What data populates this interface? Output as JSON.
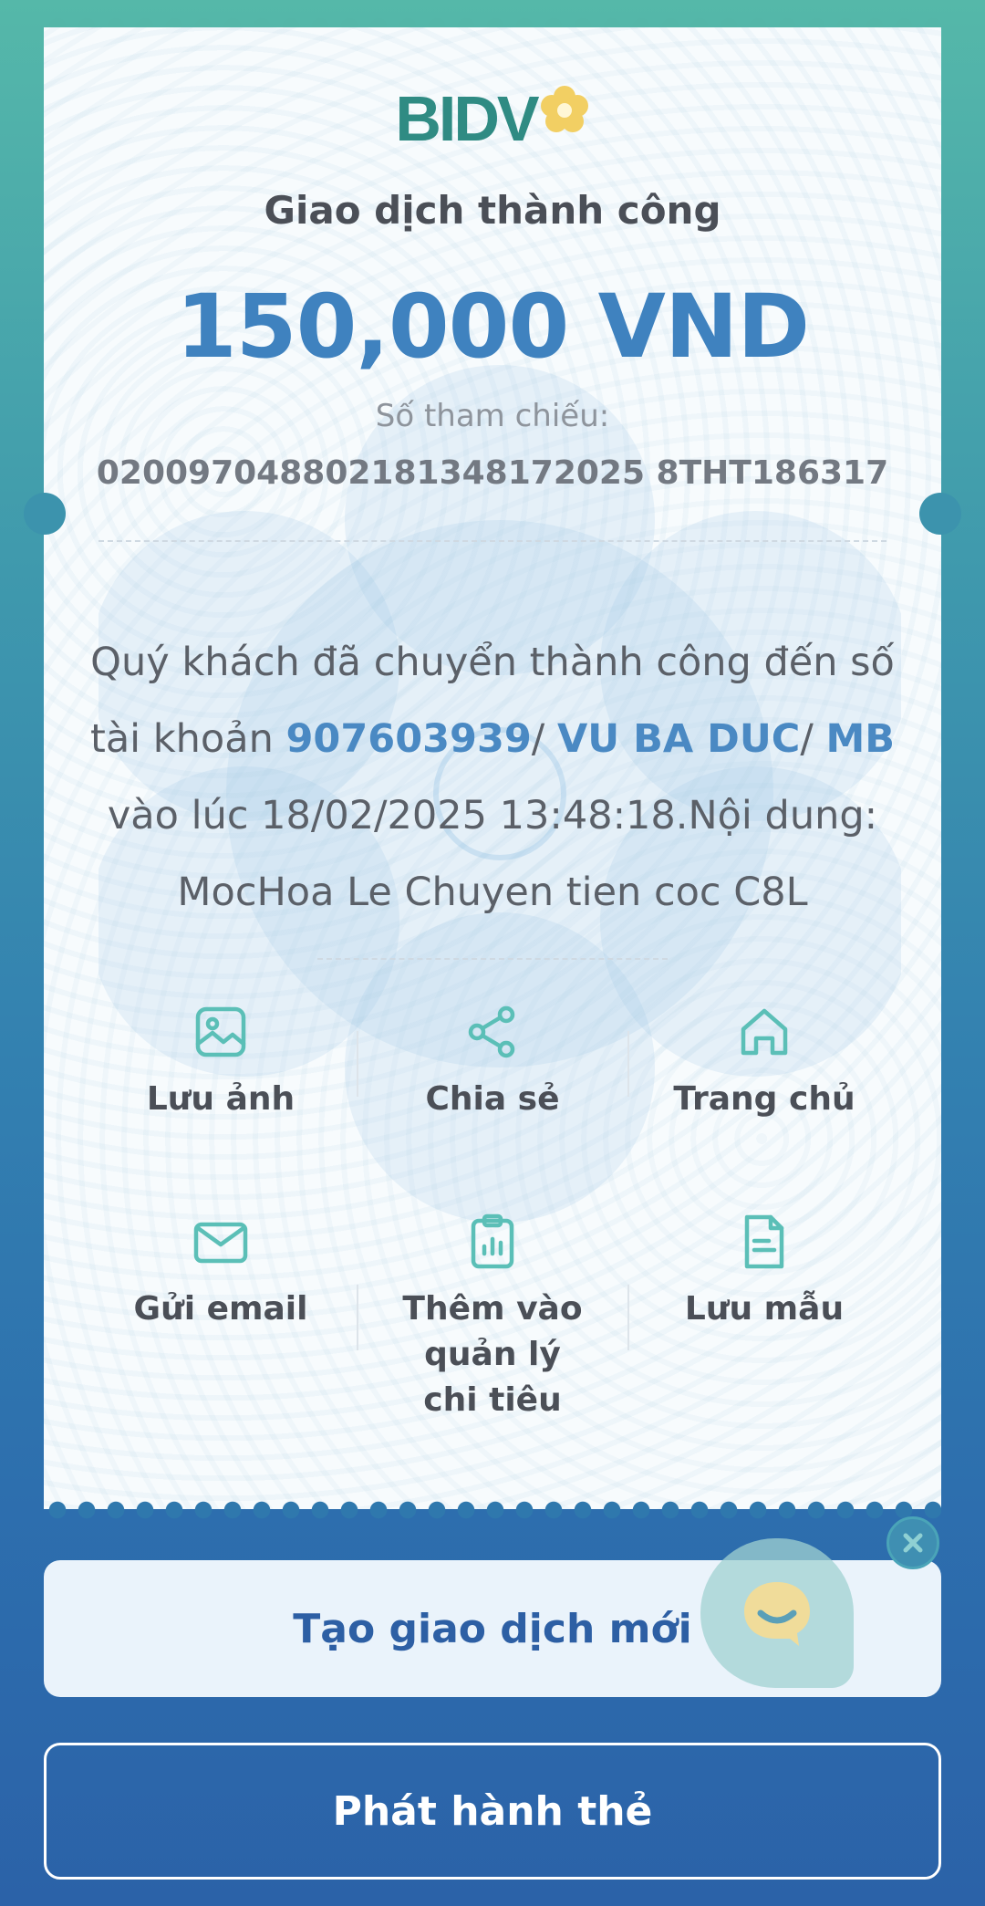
{
  "brand": {
    "logo_text": "BIDV",
    "logo_color": "#2f8b83",
    "flower_color": "#f2cf63"
  },
  "receipt": {
    "title": "Giao dịch thành công",
    "amount": "150,000 VND",
    "reference_label": "Số tham chiếu:",
    "reference_number": "020097048802181348172025 8THT186317",
    "message": {
      "part1": "Quý khách đã chuyển thành công đến số tài khoản ",
      "account": "907603939",
      "sep1": "/ ",
      "name": "VU BA DUC",
      "sep2": "/ ",
      "bank": "MB",
      "part2": " vào lúc 18/02/2025 13:48:18.Nội dung: MocHoa Le Chuyen tien coc C8L"
    }
  },
  "actions": [
    {
      "label": "Lưu ảnh",
      "icon": "image-icon"
    },
    {
      "label": "Chia sẻ",
      "icon": "share-icon"
    },
    {
      "label": "Trang chủ",
      "icon": "home-icon"
    },
    {
      "label": "Gửi email",
      "icon": "mail-icon"
    },
    {
      "label": "Thêm vào quản lý chi tiêu",
      "icon": "clipboard-chart-icon"
    },
    {
      "label": "Lưu mẫu",
      "icon": "document-icon"
    }
  ],
  "buttons": {
    "new_transaction": "Tạo giao dịch mới",
    "issue_card": "Phát hành thẻ"
  },
  "colors": {
    "accent": "#3f82bf",
    "icon_teal": "#5bbfb7",
    "primary_button_text": "#2d5fa4"
  }
}
